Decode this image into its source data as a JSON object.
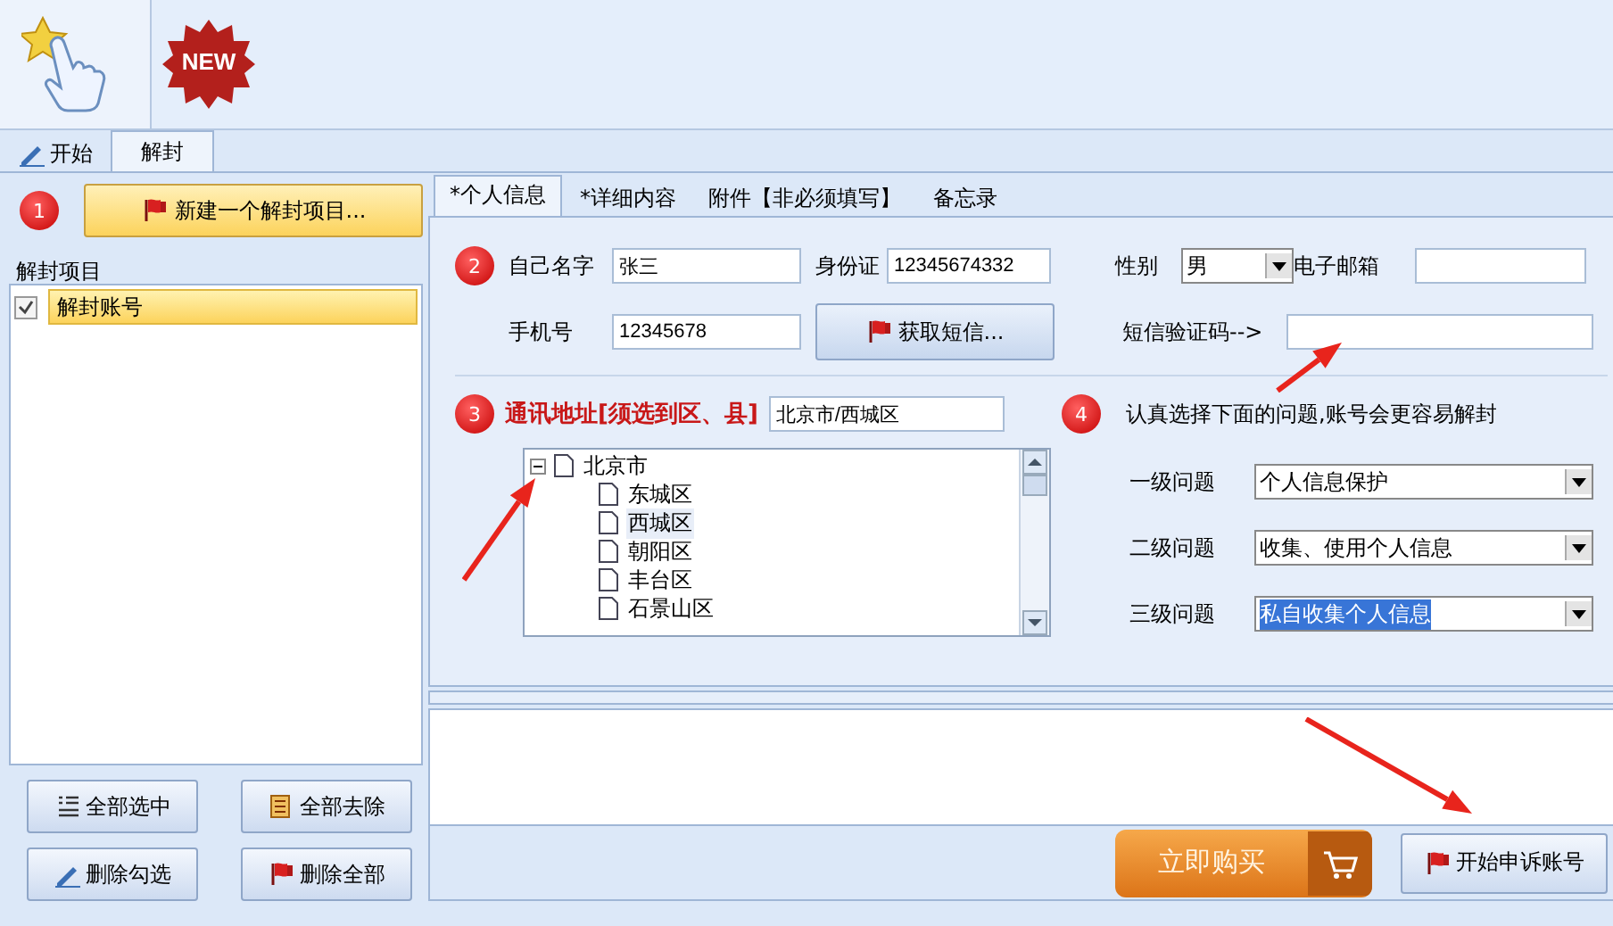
{
  "toolbar": {
    "new_badge": "NEW"
  },
  "tabs": [
    {
      "label": "开始",
      "selected": false
    },
    {
      "label": "解封",
      "selected": true
    }
  ],
  "left": {
    "step": "1",
    "new_button": "新建一个解封项目...",
    "group_label": "解封项目",
    "items": [
      {
        "label": "解封账号",
        "checked": true,
        "selected": true
      }
    ],
    "buttons": [
      {
        "label": "全部选中"
      },
      {
        "label": "全部去除"
      },
      {
        "label": "删除勾选"
      },
      {
        "label": "删除全部"
      }
    ]
  },
  "detail_tabs": [
    {
      "label": "*个人信息",
      "selected": true
    },
    {
      "label": "*详细内容",
      "selected": false
    },
    {
      "label": "附件【非必须填写】",
      "selected": false
    },
    {
      "label": "备忘录",
      "selected": false
    }
  ],
  "personal": {
    "step": "2",
    "name": {
      "label": "自己名字",
      "value": "张三"
    },
    "id_card": {
      "label": "身份证",
      "value": "12345674332"
    },
    "gender": {
      "label": "性别",
      "value": "男"
    },
    "email": {
      "label": "电子邮箱"
    },
    "phone": {
      "label": "手机号",
      "value": "12345678"
    },
    "sms_button": "获取短信...",
    "sms_code": {
      "label": "短信验证码-->"
    }
  },
  "address": {
    "step": "3",
    "label": "通讯地址[须选到区、县]",
    "value": "北京市/西城区",
    "tree": [
      {
        "label": "北京市",
        "expanded": true,
        "selected": false,
        "children": [
          {
            "label": "东城区",
            "selected": false
          },
          {
            "label": "西城区",
            "selected": true
          },
          {
            "label": "朝阳区",
            "selected": false
          },
          {
            "label": "丰台区",
            "selected": false
          },
          {
            "label": "石景山区",
            "selected": false
          }
        ]
      }
    ]
  },
  "questions": {
    "step": "4",
    "hint": "认真选择下面的问题,账号会更容易解封",
    "items": [
      {
        "label": "一级问题",
        "value": "个人信息保护",
        "highlighted": false
      },
      {
        "label": "二级问题",
        "value": "收集、使用个人信息",
        "highlighted": false
      },
      {
        "label": "三级问题",
        "value": "私自收集个人信息",
        "highlighted": true
      }
    ]
  },
  "buy_button": "立即购买",
  "start_button": "开始申诉账号"
}
